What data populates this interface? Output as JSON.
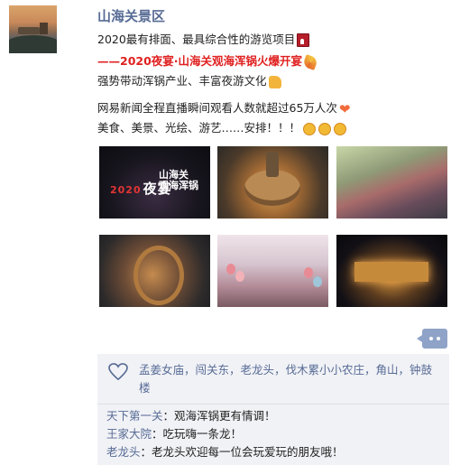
{
  "post": {
    "author": "山海关景区",
    "lines": {
      "l1": "2020最有排面、最具综合性的游览项目",
      "l2_dash": "——",
      "l2_red": "2020夜宴·山海关观海浑锅火爆开宴",
      "l3": "强势带动浑锅产业、丰富夜游文化",
      "l4": "网易新闻全程直播瞬间观看人数就超过65万人次",
      "l5": "美食、美景、光绘、游艺……安排！！！"
    },
    "icons": [
      "castle-icon",
      "party-popper-icon",
      "thumbs-up-icon",
      "heart-icon",
      "cheers-icon"
    ],
    "photos": {
      "p1_title_year": "2020",
      "p1_title_main": "夜宴",
      "p1_sub_1": "山海关",
      "p1_sub_2": "观海浑锅"
    }
  },
  "interactions": {
    "likes": "孟姜女庙，闯关东，老龙头，伐木累小小农庄，角山，钟鼓楼",
    "comments": [
      {
        "who": "天下第一关",
        "sep": "：",
        "text": "观海浑锅更有情调！"
      },
      {
        "who": "王家大院",
        "sep": "：",
        "text": "吃玩嗨一条龙！"
      },
      {
        "who": "老龙头",
        "sep": "：",
        "text": "老龙头欢迎每一位会玩爱玩的朋友哦！"
      }
    ]
  },
  "colors": {
    "name_link": "#576b95",
    "highlight_red": "#e02020",
    "comment_bg": "#f1f2f6"
  }
}
